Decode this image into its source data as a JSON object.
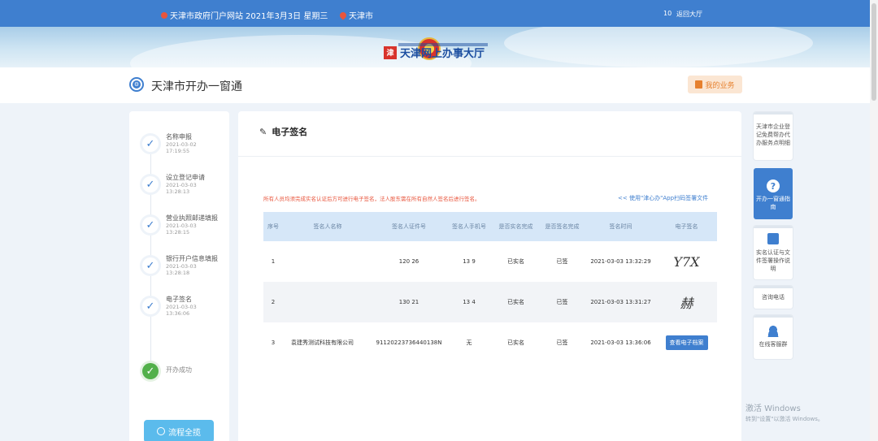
{
  "topbar": {
    "portal": "天津市政府门户网站",
    "date": "2021年3月3日 星期三",
    "city": "天津市",
    "version": "10",
    "back": "返回大厅"
  },
  "banner": {
    "hall_title": "天津网上办事大厅",
    "logo_text": "津"
  },
  "header": {
    "title": "天津市开办一窗通",
    "my_business": "我的业务"
  },
  "steps": [
    {
      "name": "名称申报",
      "time": "2021-03-02 17:19:55"
    },
    {
      "name": "设立登记申请",
      "time": "2021-03-03 13:28:13"
    },
    {
      "name": "营业执照邮递填报",
      "time": "2021-03-03 13:28:15"
    },
    {
      "name": "银行开户信息填报",
      "time": "2021-03-03 13:28:18"
    },
    {
      "name": "电子签名",
      "time": "2021-03-03 13:36:06"
    }
  ],
  "final_step": "开办成功",
  "progress_button": "流程全揽",
  "main": {
    "section_title": "电子签名",
    "note": "所有人员均须完成实名认证后方可进行电子签名，法人股东需在所有自然人签名后进行签名。",
    "app_link": "<< 使用\"津心办\"App扫码签署文件"
  },
  "table": {
    "headers": [
      "序号",
      "签名人名称",
      "签名人证件号",
      "签名人手机号",
      "是否实名完成",
      "是否签名完成",
      "签名时间",
      "电子签名"
    ],
    "rows": [
      {
        "no": "1",
        "name": "",
        "id": "120          26",
        "phone": "13          9",
        "realname": "已实名",
        "signed": "已签",
        "time": "2021-03-03 13:32:29",
        "signature": "Y7X"
      },
      {
        "no": "2",
        "name": "",
        "id": "130          21",
        "phone": "13          4",
        "realname": "已实名",
        "signed": "已签",
        "time": "2021-03-03 13:31:27",
        "signature": "赫"
      },
      {
        "no": "3",
        "name": "袁建秀测试科技有限公司",
        "id": "91120223736440138N",
        "phone": "无",
        "realname": "已实名",
        "signed": "已签",
        "time": "2021-03-03 13:36:06",
        "signature": "查看电子档案"
      }
    ]
  },
  "rail": {
    "guide_text": "天津市企业登记免费帮办代办服务点明细",
    "window_guide": "开办一窗通指南",
    "realname_doc": "实名认证与文件签署操作说明",
    "hotline": "咨询电话",
    "online_service": "在线客服群"
  },
  "watermark": {
    "line1": "激活 Windows",
    "line2": "转到\"设置\"以激活 Windows。"
  },
  "colors": {
    "primary": "#3f7fcf",
    "accent": "#e6802e",
    "success": "#52b04a",
    "warning_text": "#e8553c"
  }
}
